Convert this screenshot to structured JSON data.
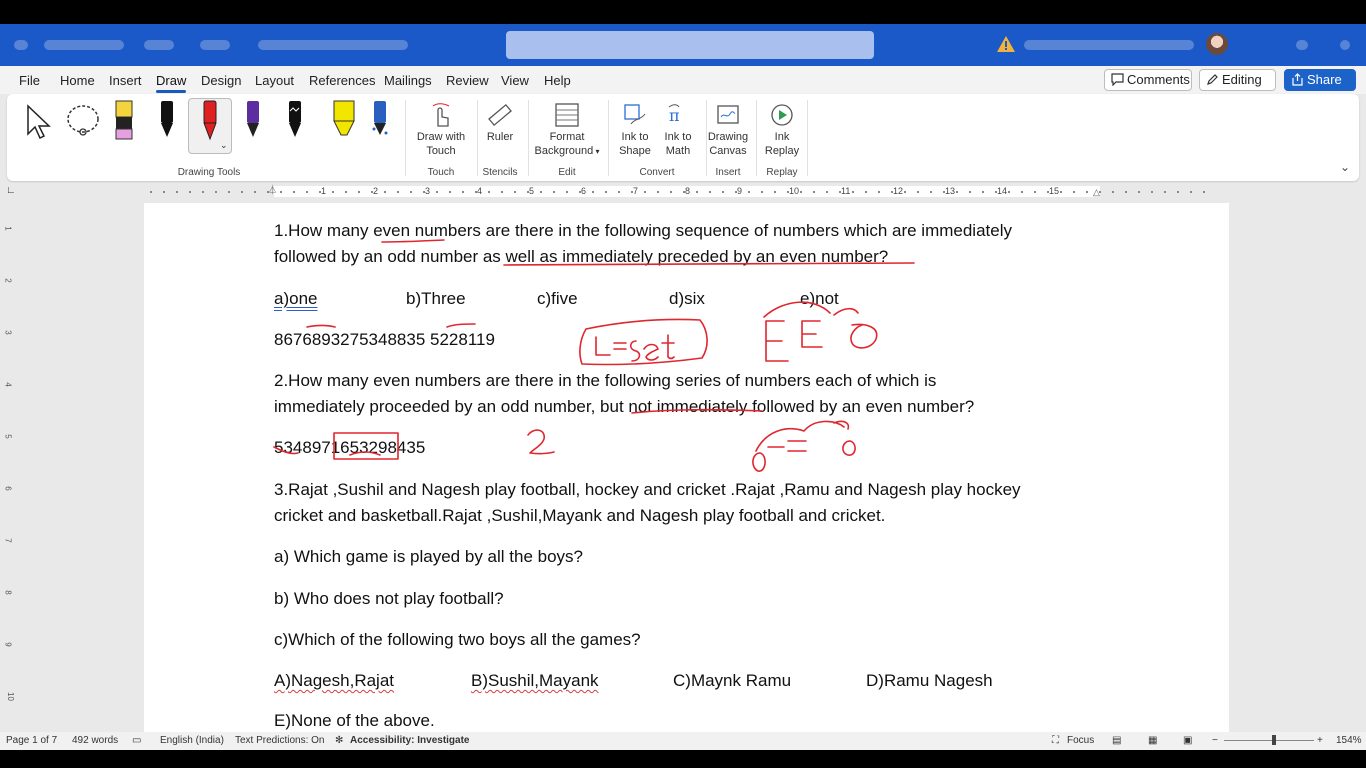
{
  "menu": {
    "tabs": [
      "File",
      "Home",
      "Insert",
      "Draw",
      "Design",
      "Layout",
      "References",
      "Mailings",
      "Review",
      "View",
      "Help"
    ],
    "active": "Draw",
    "comments_label": "Comments",
    "editing_label": "Editing",
    "share_label": "Share"
  },
  "ribbon": {
    "groups": {
      "drawing_tools": "Drawing Tools",
      "touch": "Touch",
      "stencils": "Stencils",
      "edit": "Edit",
      "convert": "Convert",
      "insert": "Insert",
      "replay": "Replay"
    },
    "buttons": {
      "draw_with_touch_1": "Draw with",
      "draw_with_touch_2": "Touch",
      "ruler": "Ruler",
      "format_bg_1": "Format",
      "format_bg_2": "Background",
      "ink_to_shape_1": "Ink to",
      "ink_to_shape_2": "Shape",
      "ink_to_math_1": "Ink to",
      "ink_to_math_2": "Math",
      "drawing_canvas_1": "Drawing",
      "drawing_canvas_2": "Canvas",
      "ink_replay_1": "Ink",
      "ink_replay_2": "Replay"
    },
    "pen_colors": [
      "#111111",
      "#e02020",
      "#5b2d9e",
      "#111111",
      "#f2e600",
      "#2a5fbf"
    ],
    "highlighter_color": "#f4d43c"
  },
  "ruler_numbers": [
    "1",
    "2",
    "3",
    "4",
    "5",
    "6",
    "7",
    "8",
    "9",
    "10",
    "11",
    "12",
    "13",
    "14",
    "15"
  ],
  "vruler_numbers": [
    "1",
    "2",
    "3",
    "4",
    "5",
    "6",
    "7",
    "8",
    "9",
    "10"
  ],
  "document": {
    "q1_line1": "1.How many even numbers are there in the following sequence of numbers which are immediately",
    "q1_line2": "followed by an odd number as well as immediately preceded by an even number?",
    "q1_options": [
      "a)one",
      "b)Three",
      "c)five",
      "d)six",
      "e)not"
    ],
    "q1_sequence": "8676893275348835 5228119",
    "q2_line1": "2.How many even numbers are there in the following series of numbers each of which is",
    "q2_line2": "immediately proceeded by an odd number, but not immediately followed by an even number?",
    "q2_sequence": "5348971653298435",
    "q3_line1": "3.Rajat ,Sushil and Nagesh play football, hockey and cricket .Rajat ,Ramu and Nagesh play hockey",
    "q3_line2": "cricket and basketball.Rajat ,Sushil,Mayank and Nagesh play football and cricket.",
    "q3a": "a) Which game is played by all the boys?",
    "q3b": "b) Who does not play football?",
    "q3c": "c)Which of the following two boys all the games?",
    "q3_options": [
      "A)Nagesh,Rajat",
      "B)Sushil,Mayank",
      "C)Maynk Ramu",
      "D)Ramu Nagesh"
    ],
    "q3_option_e": "E)None of the above."
  },
  "status": {
    "page": "Page 1 of 7",
    "words": "492 words",
    "language": "English (India)",
    "text_predictions": "Text Predictions: On",
    "accessibility": "Accessibility: Investigate",
    "focus": "Focus",
    "zoom": "154%"
  },
  "ink_color": "#e0262e"
}
